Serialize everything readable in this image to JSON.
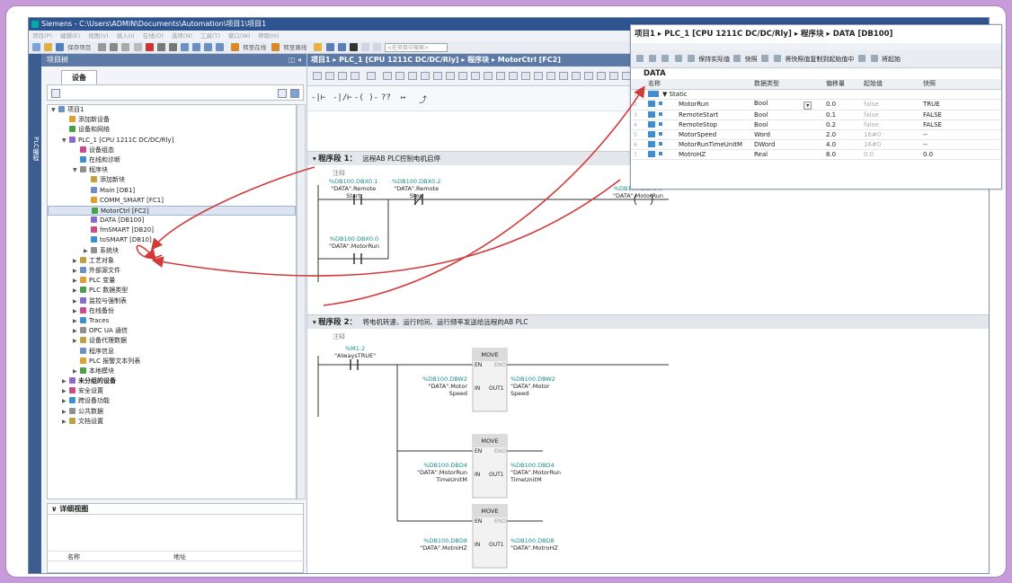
{
  "window": {
    "title": "Siemens  -  C:\\Users\\ADMIN\\Documents\\Automation\\项目1\\项目1"
  },
  "menu": [
    "项目(P)",
    "编辑(E)",
    "视图(V)",
    "插入(I)",
    "在线(O)",
    "选项(N)",
    "工具(T)",
    "窗口(W)",
    "帮助(H)"
  ],
  "toolbar": {
    "save_label": "保存项目",
    "go_online": "转至在线",
    "go_offline": "转至离线",
    "search_placeholder": "<在项目中搜索>"
  },
  "side_tab": {
    "label": "PLC编程"
  },
  "project_tree": {
    "header": "项目树",
    "tab": "设备",
    "items": [
      {
        "label": "项目1",
        "level": 0,
        "expand": "▼"
      },
      {
        "label": "添加新设备",
        "level": 1,
        "expand": ""
      },
      {
        "label": "设备和网络",
        "level": 1,
        "expand": ""
      },
      {
        "label": "PLC_1 [CPU 1211C DC/DC/Rly]",
        "level": 1,
        "expand": "▼"
      },
      {
        "label": "设备组态",
        "level": 2,
        "expand": ""
      },
      {
        "label": "在线和诊断",
        "level": 2,
        "expand": ""
      },
      {
        "label": "程序块",
        "level": 2,
        "expand": "▼"
      },
      {
        "label": "添加新块",
        "level": 3,
        "expand": ""
      },
      {
        "label": "Main [OB1]",
        "level": 3,
        "expand": ""
      },
      {
        "label": "COMM_SMART [FC1]",
        "level": 3,
        "expand": ""
      },
      {
        "label": "MotorCtrl [FC2]",
        "level": 3,
        "expand": "",
        "selected": true
      },
      {
        "label": "DATA [DB100]",
        "level": 3,
        "expand": ""
      },
      {
        "label": "fmSMART [DB20]",
        "level": 3,
        "expand": ""
      },
      {
        "label": "toSMART [DB10]",
        "level": 3,
        "expand": ""
      },
      {
        "label": "系统块",
        "level": 3,
        "expand": "▶"
      },
      {
        "label": "工艺对象",
        "level": 2,
        "expand": "▶"
      },
      {
        "label": "外部源文件",
        "level": 2,
        "expand": "▶"
      },
      {
        "label": "PLC 变量",
        "level": 2,
        "expand": "▶"
      },
      {
        "label": "PLC 数据类型",
        "level": 2,
        "expand": "▶"
      },
      {
        "label": "监控与强制表",
        "level": 2,
        "expand": "▶"
      },
      {
        "label": "在线备份",
        "level": 2,
        "expand": "▶"
      },
      {
        "label": "Traces",
        "level": 2,
        "expand": "▶"
      },
      {
        "label": "OPC UA 通信",
        "level": 2,
        "expand": "▶"
      },
      {
        "label": "设备代理数据",
        "level": 2,
        "expand": "▶"
      },
      {
        "label": "程序信息",
        "level": 2,
        "expand": ""
      },
      {
        "label": "PLC 报警文本列表",
        "level": 2,
        "expand": ""
      },
      {
        "label": "本地模块",
        "level": 2,
        "expand": "▶"
      },
      {
        "label": "未分组的设备",
        "level": 1,
        "expand": "▶",
        "bold": true
      },
      {
        "label": "安全设置",
        "level": 1,
        "expand": "▶"
      },
      {
        "label": "跨设备功能",
        "level": 1,
        "expand": "▶"
      },
      {
        "label": "公共数据",
        "level": 1,
        "expand": "▶"
      },
      {
        "label": "文档设置",
        "level": 1,
        "expand": "▶"
      }
    ],
    "detail_view": {
      "title": "详细视图",
      "col_name": "名称",
      "col_addr": "地址"
    }
  },
  "editor": {
    "breadcrumb": "项目1 ▸ PLC_1 [CPU 1211C DC/DC/Rly] ▸ 程序块 ▸ MotorCtrl [FC2]",
    "ladder_tools": [
      "-|⊢",
      "-|/⊢",
      "-( )-",
      "??",
      "↦",
      "⤴"
    ],
    "network1": {
      "label": "程序段 1：",
      "title": "远程AB PLC控制电机启停",
      "comment": "注释"
    },
    "network2": {
      "label": "程序段 2：",
      "title": "将电机转速、运行时间、运行频率发送给远程的AB PLC",
      "comment": "注释"
    },
    "contacts": [
      {
        "addr": "%DB100.DBX0.1",
        "name": "\"DATA\".Remote",
        "name2": "Start"
      },
      {
        "addr": "%DB100.DBX0.2",
        "name": "\"DATA\".Remote",
        "name2": "Stop"
      },
      {
        "addr": "%DB100.DBX0.0",
        "name": "\"DATA\".MotorRun",
        "name2": ""
      },
      {
        "addr": "%DB100.DBX0.0",
        "name": "\"DATA\".MotorRun",
        "name2": ""
      }
    ],
    "always_true": {
      "addr": "%M1.2",
      "name": "\"AlwaysTRUE\""
    },
    "move_label": "MOVE",
    "en": "EN",
    "eno": "ENO",
    "in": "IN",
    "out1": "OUT1",
    "moves": [
      {
        "in_addr": "%DB100.DBW2",
        "in_name": "\"DATA\".Motor",
        "in_name2": "Speed",
        "out_addr": "%DB100.DBW2",
        "out_name": "\"DATA\".Motor",
        "out_name2": "Speed"
      },
      {
        "in_addr": "%DB100.DBD4",
        "in_name": "\"DATA\".MotorRun",
        "in_name2": "TimeUnitM",
        "out_addr": "%DB100.DBD4",
        "out_name": "\"DATA\".MotorRun",
        "out_name2": "TimeUnitM"
      },
      {
        "in_addr": "%DB100.DBD8",
        "in_name": "\"DATA\".MotroHZ",
        "in_name2": "",
        "out_addr": "%DB100.DBD8",
        "out_name": "\"DATA\".MotroHZ",
        "out_name2": ""
      }
    ]
  },
  "db_panel": {
    "breadcrumb": "项目1 ▸ PLC_1 [CPU 1211C DC/DC/Rly] ▸ 程序块 ▸ DATA [DB100]",
    "tools": [
      "保持实际值",
      "快照",
      "将快照值复制到起始值中",
      "将起始"
    ],
    "title": "DATA",
    "columns": [
      "名称",
      "数据类型",
      "偏移量",
      "起始值",
      "快照"
    ],
    "static_label": "Static",
    "rows": [
      {
        "num": "2",
        "name": "MotorRun",
        "type": "Bool",
        "offset": "0.0",
        "start": "false",
        "snapshot": "TRUE"
      },
      {
        "num": "3",
        "name": "RemoteStart",
        "type": "Bool",
        "offset": "0.1",
        "start": "false",
        "snapshot": "FALSE"
      },
      {
        "num": "4",
        "name": "RemoteStop",
        "type": "Bool",
        "offset": "0.2",
        "start": "false",
        "snapshot": "FALSE"
      },
      {
        "num": "5",
        "name": "MotorSpeed",
        "type": "Word",
        "offset": "2.0",
        "start": "16#0",
        "snapshot": "--"
      },
      {
        "num": "6",
        "name": "MotorRunTimeUnitM",
        "type": "DWord",
        "offset": "4.0",
        "start": "16#0",
        "snapshot": "--"
      },
      {
        "num": "7",
        "name": "MotroHZ",
        "type": "Real",
        "offset": "8.0",
        "start": "0.0",
        "snapshot": "0.0"
      }
    ]
  },
  "colors": {
    "accent": "#2f5590",
    "operand_addr": "#1a8a8a",
    "arrow": "#d23a3a",
    "frame": "#c79ad9"
  }
}
